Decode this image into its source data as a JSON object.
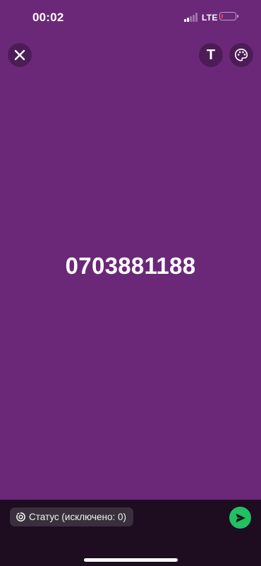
{
  "status_bar": {
    "time": "00:02",
    "network": "LTE",
    "battery_level": 0.1,
    "battery_color": "#ff3b30"
  },
  "top_bar": {
    "close_icon": "close-icon",
    "text_icon": "text-T-icon",
    "text_glyph": "T",
    "palette_icon": "palette-icon"
  },
  "canvas": {
    "background_color": "#6b2878",
    "text": "0703881188"
  },
  "composer": {
    "status_label": "Статус (исключено: 0)",
    "status_icon": "status-ring-icon",
    "send_icon": "send-icon",
    "send_color": "#21c063"
  }
}
